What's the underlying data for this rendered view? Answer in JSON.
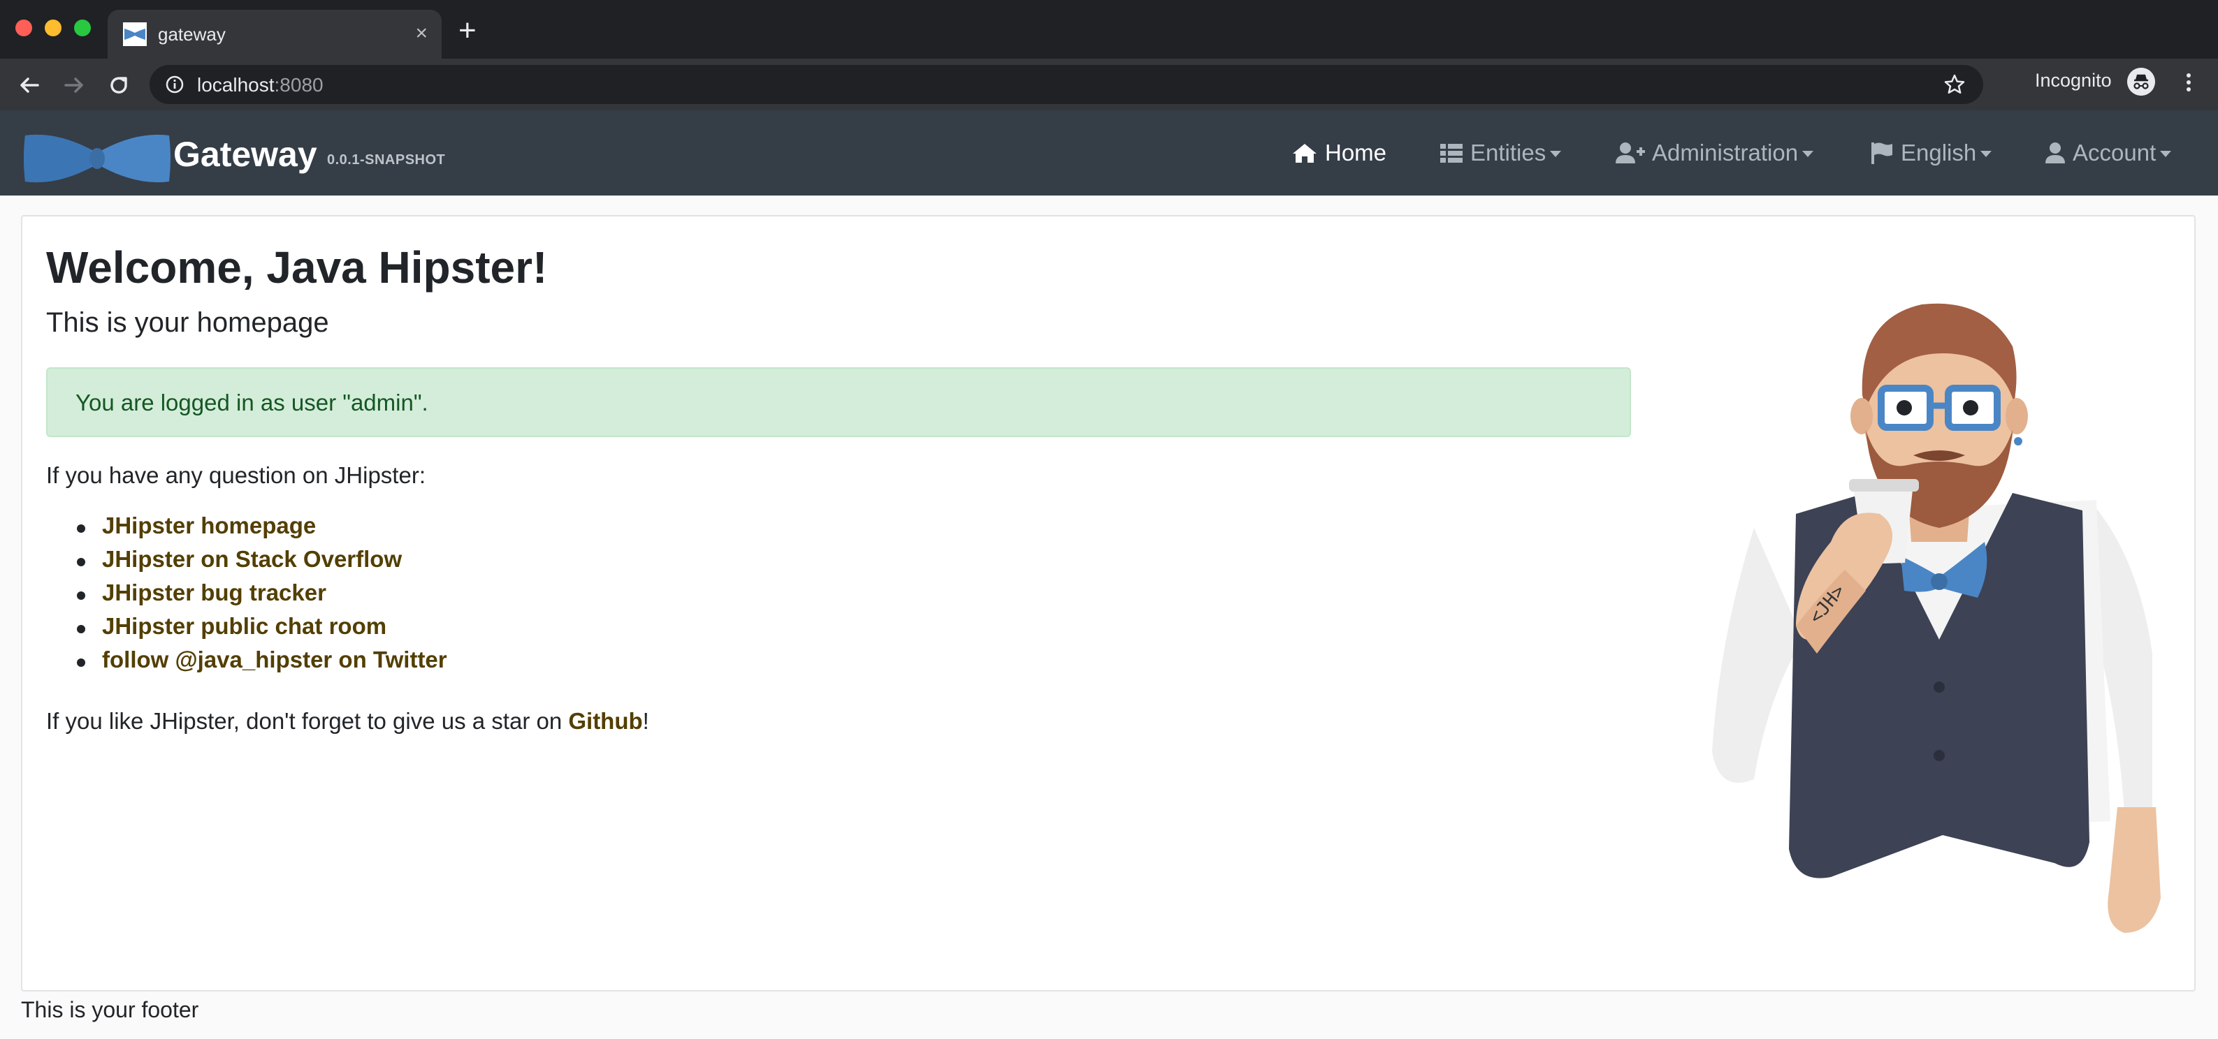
{
  "browser": {
    "tab_title": "gateway",
    "new_tab": "+",
    "close": "×",
    "url_host": "localhost",
    "url_port": ":8080",
    "incognito_label": "Incognito"
  },
  "navbar": {
    "brand": "Gateway",
    "version": "0.0.1-SNAPSHOT",
    "items": [
      {
        "label": "Home",
        "icon": "home-icon"
      },
      {
        "label": "Entities",
        "icon": "th-list-icon"
      },
      {
        "label": "Administration",
        "icon": "user-plus-icon"
      },
      {
        "label": "English",
        "icon": "flag-icon"
      },
      {
        "label": "Account",
        "icon": "user-icon"
      }
    ]
  },
  "main": {
    "title": "Welcome, Java Hipster!",
    "subtitle": "This is your homepage",
    "alert": "You are logged in as user \"admin\".",
    "question": "If you have any question on JHipster:",
    "links": [
      "JHipster homepage",
      "JHipster on Stack Overflow",
      "JHipster bug tracker",
      "JHipster public chat room",
      "follow @java_hipster on Twitter"
    ],
    "star_prefix": "If you like JHipster, don't forget to give us a star on ",
    "star_link": "Github",
    "star_suffix": "!"
  },
  "footer": {
    "text": "This is your footer"
  },
  "colors": {
    "navbar_bg": "#353d47",
    "link": "#533f03",
    "alert_bg": "#d4edda",
    "alert_text": "#155724",
    "logo_blue": "#4a86c5"
  }
}
